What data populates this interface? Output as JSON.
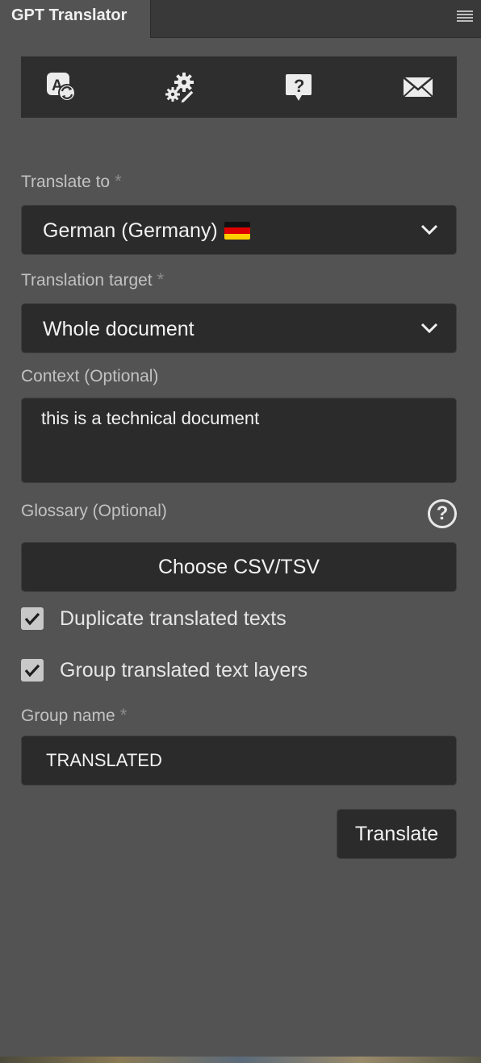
{
  "header": {
    "tab_title": "GPT Translator",
    "menu_icon": "hamburger-menu-icon"
  },
  "toolbar": {
    "items": [
      {
        "icon": "translate-icon"
      },
      {
        "icon": "settings-gears-icon"
      },
      {
        "icon": "help-bubble-icon"
      },
      {
        "icon": "mail-icon"
      }
    ]
  },
  "form": {
    "translate_to_label": "Translate to",
    "translate_to_value": "German (Germany)",
    "translate_to_flag": "german-flag-icon",
    "target_label": "Translation target",
    "target_value": "Whole document",
    "context_label": "Context (Optional)",
    "context_value": "this is a technical document",
    "glossary_label": "Glossary (Optional)",
    "glossary_help": "?",
    "glossary_button": "Choose CSV/TSV",
    "duplicate_label": "Duplicate translated texts",
    "duplicate_checked": true,
    "group_label": "Group translated text layers",
    "group_checked": true,
    "group_name_label": "Group name",
    "group_name_value": "TRANSLATED",
    "required_mark": "*",
    "translate_button": "Translate"
  },
  "colors": {
    "panel_bg": "#535353",
    "field_bg": "#2b2b2b",
    "toolbar_bg": "#2e2e2e",
    "text": "#f2f2f2",
    "label": "#c2c2c2"
  }
}
